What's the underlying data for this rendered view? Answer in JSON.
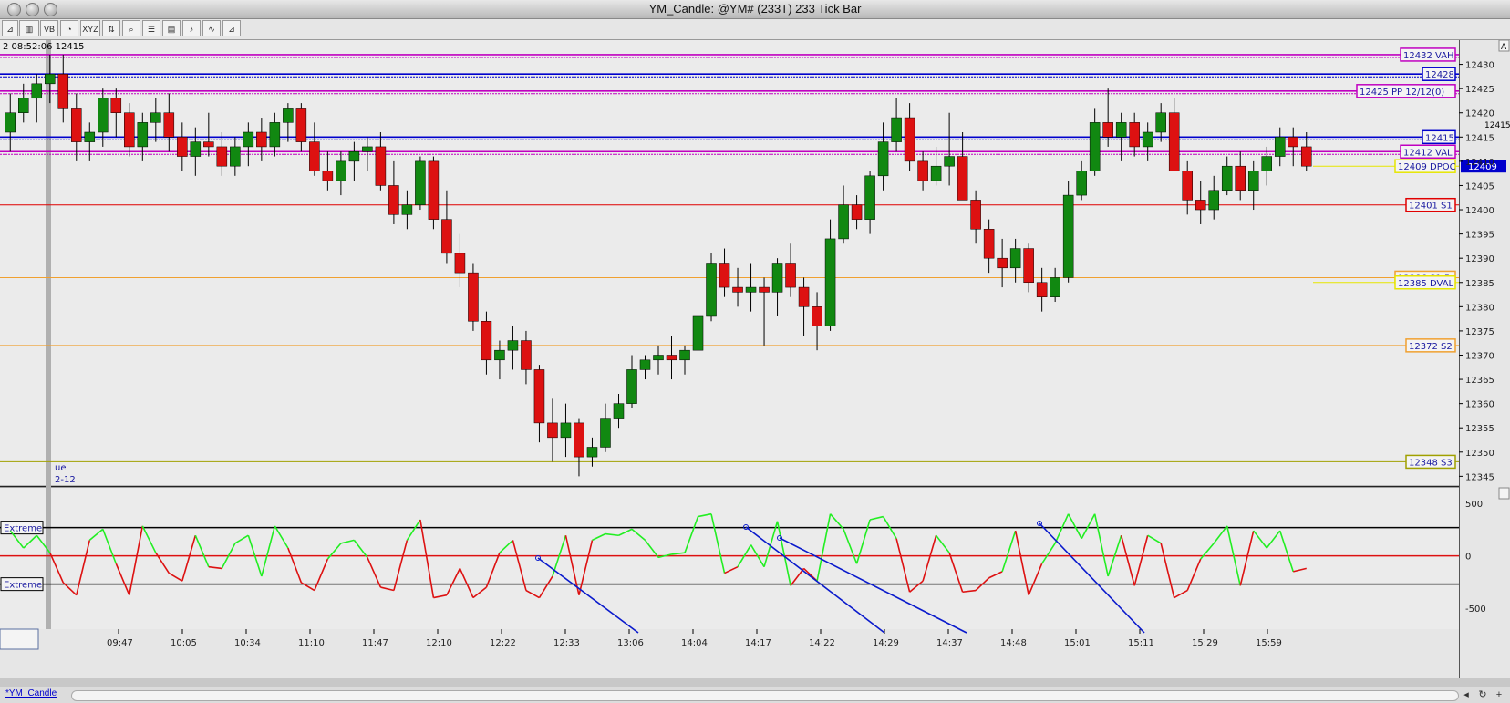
{
  "window": {
    "title": "YM_Candle: @YM# (233T) 233 Tick Bar"
  },
  "toolbar": {
    "items": [
      "draw-trend-icon",
      "chart-type-icon",
      "VB",
      "timer-icon",
      "XYZ",
      "indicator-icon",
      "zoom-icon",
      "grid-icon",
      "chart-icon",
      "alert-icon",
      "strategy-icon",
      "analysis-icon"
    ],
    "vb_label": "VB",
    "xyz_label": "XYZ"
  },
  "status": {
    "readout": "2 08:52:06 12415",
    "date_label_1": "ue",
    "date_label_2": "2-12"
  },
  "bottom": {
    "tab": "*YM_Candle"
  },
  "chart_data": {
    "type": "candlestick",
    "title": "YM_Candle: @YM# (233T) 233 Tick Bar",
    "y_axis": {
      "ticks": [
        12345,
        12350,
        12355,
        12360,
        12365,
        12370,
        12375,
        12380,
        12385,
        12390,
        12395,
        12400,
        12405,
        12410,
        12415,
        12420,
        12425,
        12430
      ],
      "ylim": [
        12343,
        12435
      ]
    },
    "x_axis": {
      "ticks": [
        "09:47",
        "10:05",
        "10:34",
        "11:10",
        "11:47",
        "12:10",
        "12:22",
        "12:33",
        "13:06",
        "14:04",
        "14:17",
        "14:22",
        "14:29",
        "14:37",
        "14:48",
        "15:01",
        "15:11",
        "15:29",
        "15:59"
      ]
    },
    "last_price_label": "12409",
    "top_right_value": "12415",
    "levels": [
      {
        "label": "12432 VAH",
        "value": 12432,
        "color": "#c000c0",
        "style": "double"
      },
      {
        "label": "12428",
        "value": 12428,
        "color": "#0000cc",
        "style": "double"
      },
      {
        "label": "12425 PP 12/12(0)",
        "value": 12424.5,
        "color": "#c000c0",
        "style": "double"
      },
      {
        "label": "12415",
        "value": 12415,
        "color": "#0000cc",
        "style": "double"
      },
      {
        "label": "12412 VAL",
        "value": 12412,
        "color": "#c000c0",
        "style": "double"
      },
      {
        "label": "12409 DPOC",
        "value": 12409,
        "color": "#e6e600",
        "style": "short"
      },
      {
        "label": "12401 S1",
        "value": 12401,
        "color": "#e00000",
        "style": "single"
      },
      {
        "label": "12386 S1.5",
        "value": 12386,
        "color": "#f0a030",
        "style": "single"
      },
      {
        "label": "12385 DVAL",
        "value": 12385,
        "color": "#e6e600",
        "style": "short"
      },
      {
        "label": "12372 S2",
        "value": 12372,
        "color": "#f0a030",
        "style": "single"
      },
      {
        "label": "12348 S3",
        "value": 12348,
        "color": "#a0a000",
        "style": "single"
      }
    ],
    "candles": [
      [
        12416,
        12424,
        12412,
        12420
      ],
      [
        12420,
        12426,
        12418,
        12423
      ],
      [
        12423,
        12428,
        12418,
        12426
      ],
      [
        12426,
        12432,
        12422,
        12428
      ],
      [
        12428,
        12432,
        12418,
        12421
      ],
      [
        12421,
        12424,
        12410,
        12414
      ],
      [
        12414,
        12418,
        12410,
        12416
      ],
      [
        12416,
        12425,
        12413,
        12423
      ],
      [
        12423,
        12425,
        12415,
        12420
      ],
      [
        12420,
        12422,
        12411,
        12413
      ],
      [
        12413,
        12420,
        12410,
        12418
      ],
      [
        12418,
        12423,
        12414,
        12420
      ],
      [
        12420,
        12424,
        12412,
        12415
      ],
      [
        12415,
        12418,
        12408,
        12411
      ],
      [
        12411,
        12417,
        12407,
        12414
      ],
      [
        12414,
        12420,
        12411,
        12413
      ],
      [
        12413,
        12416,
        12407,
        12409
      ],
      [
        12409,
        12415,
        12407,
        12413
      ],
      [
        12413,
        12418,
        12409,
        12416
      ],
      [
        12416,
        12419,
        12410,
        12413
      ],
      [
        12413,
        12420,
        12411,
        12418
      ],
      [
        12418,
        12422,
        12414,
        12421
      ],
      [
        12421,
        12422,
        12412,
        12414
      ],
      [
        12414,
        12418,
        12407,
        12408
      ],
      [
        12408,
        12412,
        12404,
        12406
      ],
      [
        12406,
        12412,
        12403,
        12410
      ],
      [
        12410,
        12414,
        12406,
        12412
      ],
      [
        12412,
        12415,
        12408,
        12413
      ],
      [
        12413,
        12416,
        12404,
        12405
      ],
      [
        12405,
        12410,
        12397,
        12399
      ],
      [
        12399,
        12404,
        12396,
        12401
      ],
      [
        12401,
        12411,
        12400,
        12410
      ],
      [
        12410,
        12411,
        12396,
        12398
      ],
      [
        12398,
        12404,
        12389,
        12391
      ],
      [
        12391,
        12395,
        12384,
        12387
      ],
      [
        12387,
        12389,
        12375,
        12377
      ],
      [
        12377,
        12379,
        12366,
        12369
      ],
      [
        12369,
        12373,
        12365,
        12371
      ],
      [
        12371,
        12376,
        12367,
        12373
      ],
      [
        12373,
        12375,
        12364,
        12367
      ],
      [
        12367,
        12368,
        12352,
        12356
      ],
      [
        12356,
        12361,
        12348,
        12353
      ],
      [
        12353,
        12360,
        12349,
        12356
      ],
      [
        12356,
        12357,
        12345,
        12349
      ],
      [
        12349,
        12353,
        12347,
        12351
      ],
      [
        12351,
        12360,
        12350,
        12357
      ],
      [
        12357,
        12362,
        12355,
        12360
      ],
      [
        12360,
        12370,
        12359,
        12367
      ],
      [
        12367,
        12370,
        12365,
        12369
      ],
      [
        12369,
        12372,
        12366,
        12370
      ],
      [
        12370,
        12374,
        12365,
        12369
      ],
      [
        12369,
        12372,
        12366,
        12371
      ],
      [
        12371,
        12380,
        12370,
        12378
      ],
      [
        12378,
        12391,
        12377,
        12389
      ],
      [
        12389,
        12392,
        12382,
        12384
      ],
      [
        12384,
        12388,
        12380,
        12383
      ],
      [
        12383,
        12389,
        12379,
        12384
      ],
      [
        12384,
        12386,
        12372,
        12383
      ],
      [
        12383,
        12390,
        12378,
        12389
      ],
      [
        12389,
        12393,
        12382,
        12384
      ],
      [
        12384,
        12386,
        12374,
        12380
      ],
      [
        12380,
        12383,
        12371,
        12376
      ],
      [
        12376,
        12398,
        12375,
        12394
      ],
      [
        12394,
        12405,
        12393,
        12401
      ],
      [
        12401,
        12403,
        12396,
        12398
      ],
      [
        12398,
        12408,
        12395,
        12407
      ],
      [
        12407,
        12418,
        12404,
        12414
      ],
      [
        12414,
        12423,
        12412,
        12419
      ],
      [
        12419,
        12422,
        12408,
        12410
      ],
      [
        12410,
        12412,
        12404,
        12406
      ],
      [
        12406,
        12413,
        12405,
        12409
      ],
      [
        12409,
        12420,
        12405,
        12411
      ],
      [
        12411,
        12416,
        12403,
        12402
      ],
      [
        12402,
        12404,
        12393,
        12396
      ],
      [
        12396,
        12398,
        12387,
        12390
      ],
      [
        12390,
        12394,
        12384,
        12388
      ],
      [
        12388,
        12394,
        12385,
        12392
      ],
      [
        12392,
        12393,
        12383,
        12385
      ],
      [
        12385,
        12388,
        12379,
        12382
      ],
      [
        12382,
        12388,
        12381,
        12386
      ],
      [
        12386,
        12406,
        12385,
        12403
      ],
      [
        12403,
        12410,
        12402,
        12408
      ],
      [
        12408,
        12421,
        12407,
        12418
      ],
      [
        12418,
        12425,
        12413,
        12415
      ],
      [
        12415,
        12420,
        12410,
        12418
      ],
      [
        12418,
        12420,
        12411,
        12413
      ],
      [
        12413,
        12418,
        12410,
        12416
      ],
      [
        12416,
        12422,
        12414,
        12420
      ],
      [
        12420,
        12423,
        12411,
        12408
      ],
      [
        12408,
        12410,
        12399,
        12402
      ],
      [
        12402,
        12406,
        12397,
        12400
      ],
      [
        12400,
        12407,
        12398,
        12404
      ],
      [
        12404,
        12411,
        12403,
        12409
      ],
      [
        12409,
        12412,
        12402,
        12404
      ],
      [
        12404,
        12410,
        12400,
        12408
      ],
      [
        12408,
        12413,
        12405,
        12411
      ],
      [
        12411,
        12417,
        12409,
        12415
      ],
      [
        12415,
        12417,
        12409,
        12413
      ],
      [
        12413,
        12416,
        12408,
        12409
      ]
    ],
    "oscillator": {
      "name": "",
      "extreme_labels": [
        "Extreme",
        "Extreme"
      ],
      "ticks": [
        500,
        0,
        -500
      ],
      "ylim": [
        -700,
        650
      ],
      "extreme_levels": [
        270,
        -270
      ]
    }
  }
}
